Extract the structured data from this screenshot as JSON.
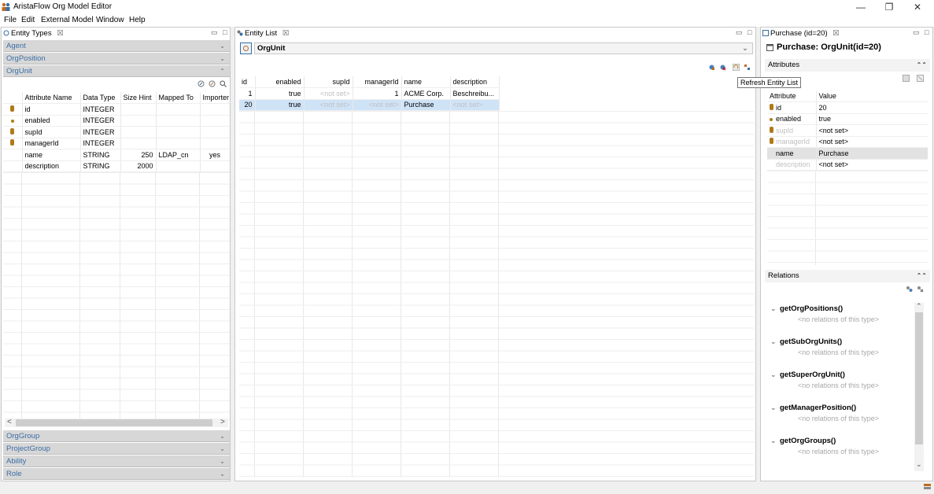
{
  "window": {
    "title": "AristaFlow Org Model Editor",
    "controls": {
      "minimize": "—",
      "restore": "❐",
      "close": "✕"
    }
  },
  "menu": [
    "File",
    "Edit",
    "External Model",
    "Window",
    "Help"
  ],
  "left": {
    "tab_label": "Entity Types",
    "tab_close": "☒",
    "accordion_top": [
      "Agent",
      "OrgPosition",
      "OrgUnit"
    ],
    "accordion_bottom": [
      "OrgGroup",
      "ProjectGroup",
      "Ability",
      "Role"
    ],
    "columns": [
      "Attribute Name",
      "Data Type",
      "Size Hint",
      "Mapped To",
      "Importer"
    ],
    "rows": [
      {
        "icon": "key",
        "name": "id",
        "type": "INTEGER",
        "size": "",
        "mapped": "",
        "importer": ""
      },
      {
        "icon": "dot",
        "name": "enabled",
        "type": "INTEGER",
        "size": "",
        "mapped": "",
        "importer": ""
      },
      {
        "icon": "key",
        "name": "supId",
        "type": "INTEGER",
        "size": "",
        "mapped": "",
        "importer": ""
      },
      {
        "icon": "key",
        "name": "managerId",
        "type": "INTEGER",
        "size": "",
        "mapped": "",
        "importer": ""
      },
      {
        "icon": "",
        "name": "name",
        "type": "STRING",
        "size": "250",
        "mapped": "LDAP_cn",
        "importer": "yes"
      },
      {
        "icon": "",
        "name": "description",
        "type": "STRING",
        "size": "2000",
        "mapped": "",
        "importer": ""
      }
    ],
    "scroll_left": "<",
    "scroll_right": ">"
  },
  "center": {
    "tab_label": "Entity List",
    "tab_close": "☒",
    "entity_selector": "OrgUnit",
    "tooltip": "Refresh Entity List",
    "columns": [
      "id",
      "enabled",
      "supId",
      "managerId",
      "name",
      "description"
    ],
    "rows": [
      {
        "id": "1",
        "enabled": "true",
        "supId": "<not set>",
        "managerId": "1",
        "name": "ACME Corp.",
        "description": "Beschreibu..."
      },
      {
        "id": "20",
        "enabled": "true",
        "supId": "<not set>",
        "managerId": "<not set>",
        "name": "Purchase",
        "description": "<not set>"
      }
    ]
  },
  "right": {
    "tab_label": "Purchase (id=20)",
    "tab_close": "☒",
    "header": "Purchase: OrgUnit(id=20)",
    "attributes_title": "Attributes",
    "attr_columns": [
      "Attribute",
      "Value"
    ],
    "attr_rows": [
      {
        "icon": "key",
        "name": "id",
        "value": "20",
        "dim": false
      },
      {
        "icon": "dot",
        "name": "enabled",
        "value": "true",
        "dim": false
      },
      {
        "icon": "key",
        "name": "supId",
        "value": "<not set>",
        "dim": true
      },
      {
        "icon": "key",
        "name": "managerId",
        "value": "<not set>",
        "dim": true
      },
      {
        "icon": "",
        "name": "name",
        "value": "Purchase",
        "dim": false
      },
      {
        "icon": "",
        "name": "description",
        "value": "<not set>",
        "dim": true
      }
    ],
    "relations_title": "Relations",
    "relations": [
      {
        "name": "getOrgPositions()",
        "desc": "<no relations of this type>"
      },
      {
        "name": "getSubOrgUnits()",
        "desc": "<no relations of this type>"
      },
      {
        "name": "getSuperOrgUnit()",
        "desc": "<no relations of this type>"
      },
      {
        "name": "getManagerPosition()",
        "desc": "<no relations of this type>"
      },
      {
        "name": "getOrgGroups()",
        "desc": "<no relations of this type>"
      }
    ]
  }
}
